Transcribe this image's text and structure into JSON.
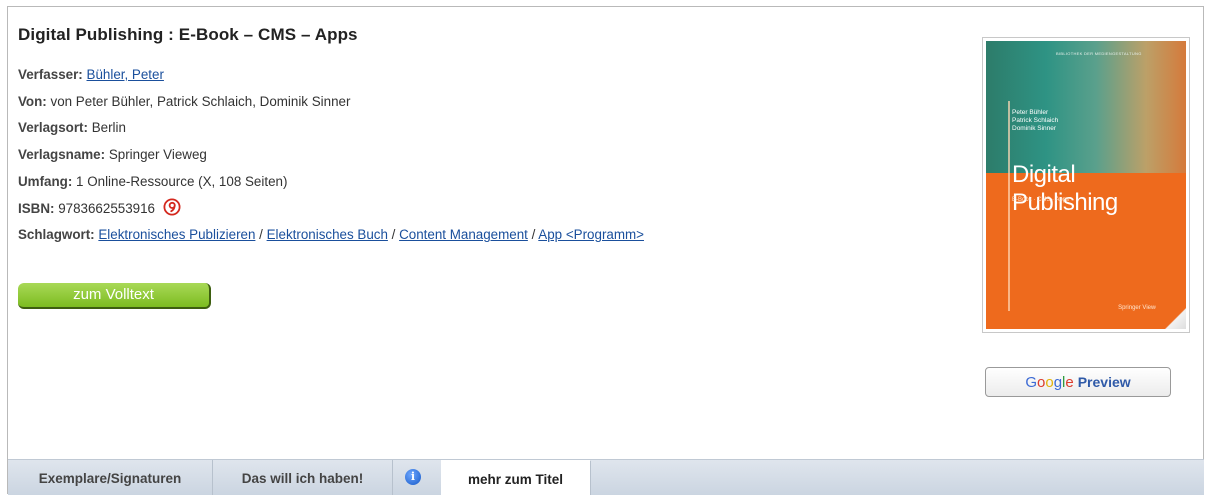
{
  "record": {
    "title": "Digital Publishing : E-Book – CMS – Apps",
    "author_label": "Verfasser:",
    "author_link": "Bühler, Peter",
    "by_label": "Von:",
    "by_value": "von Peter Bühler, Patrick Schlaich, Dominik Sinner",
    "place_label": "Verlagsort:",
    "place_value": "Berlin",
    "publisher_label": "Verlagsname:",
    "publisher_value": "Springer Vieweg",
    "extent_label": "Umfang:",
    "extent_value": "1 Online-Ressource (X, 108 Seiten)",
    "isbn_label": "ISBN:",
    "isbn_value": "9783662553916",
    "subject_label": "Schlagwort:",
    "subjects": [
      "Elektronisches Publizieren",
      "Elektronisches Buch",
      "Content Management",
      "App <Programm>"
    ],
    "subject_separator": " / "
  },
  "actions": {
    "fulltext_label": "zum Volltext"
  },
  "cover": {
    "series": "BIBLIOTHEK DER MEDIENGESTALTUNG",
    "authors": [
      "Peter Bühler",
      "Patrick Schlaich",
      "Dominik Sinner"
    ],
    "title": "Digital Publishing",
    "subtitle": "E-Book · CMS · Apps",
    "publisher": "Springer Vieweg"
  },
  "google_preview": {
    "letters": [
      "G",
      "o",
      "o",
      "g",
      "l",
      "e"
    ],
    "preview_label": "Preview"
  },
  "tabs": [
    {
      "label": "Exemplare/Signaturen",
      "active": false
    },
    {
      "label": "Das will ich haben!",
      "active": false
    },
    {
      "label": "mehr zum Titel",
      "active": true
    }
  ],
  "icons": {
    "open_access": "open-access-icon",
    "info": "info-icon"
  },
  "colors": {
    "link": "#1a4f9c",
    "fulltext_button": "#7cbc20",
    "cover_orange": "#ee6a1d",
    "open_access_red": "#d4281e",
    "tabbar": "#cbd5e1"
  }
}
